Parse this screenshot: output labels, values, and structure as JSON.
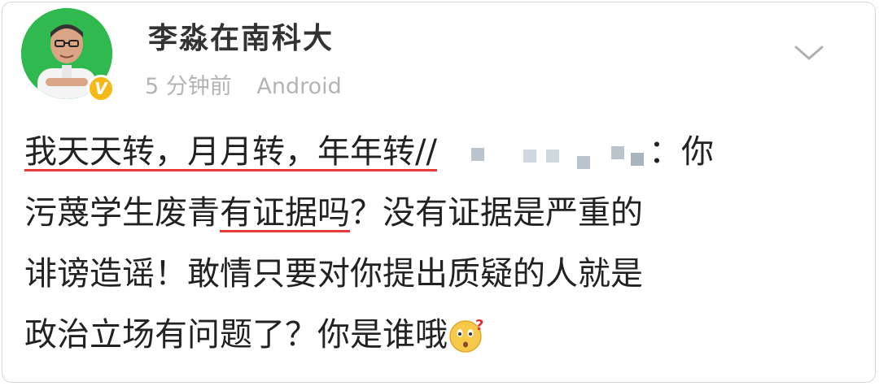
{
  "post": {
    "username": "李淼在南科大",
    "time": "5 分钟前",
    "source": "Android",
    "line1_underlined": "我天天转，月月转，年年转//",
    "line1_tail": "：你",
    "line2_head": "污蔑学生废青",
    "line2_underlined": "有证据吗",
    "line2_tail": "？没有证据是严重的",
    "line3": "诽谤造谣！敢情只要对你提出质疑的人就是",
    "line4": "政治立场有问题了？你是谁哦"
  },
  "icons": {
    "verified_badge": "verified-v-icon",
    "dropdown": "chevron-down-icon",
    "emoji": "confused-face-emoji-icon"
  },
  "colors": {
    "underline": "#e83a3a",
    "verified": "#f6b817",
    "avatar_bg": "#2fb94e"
  }
}
